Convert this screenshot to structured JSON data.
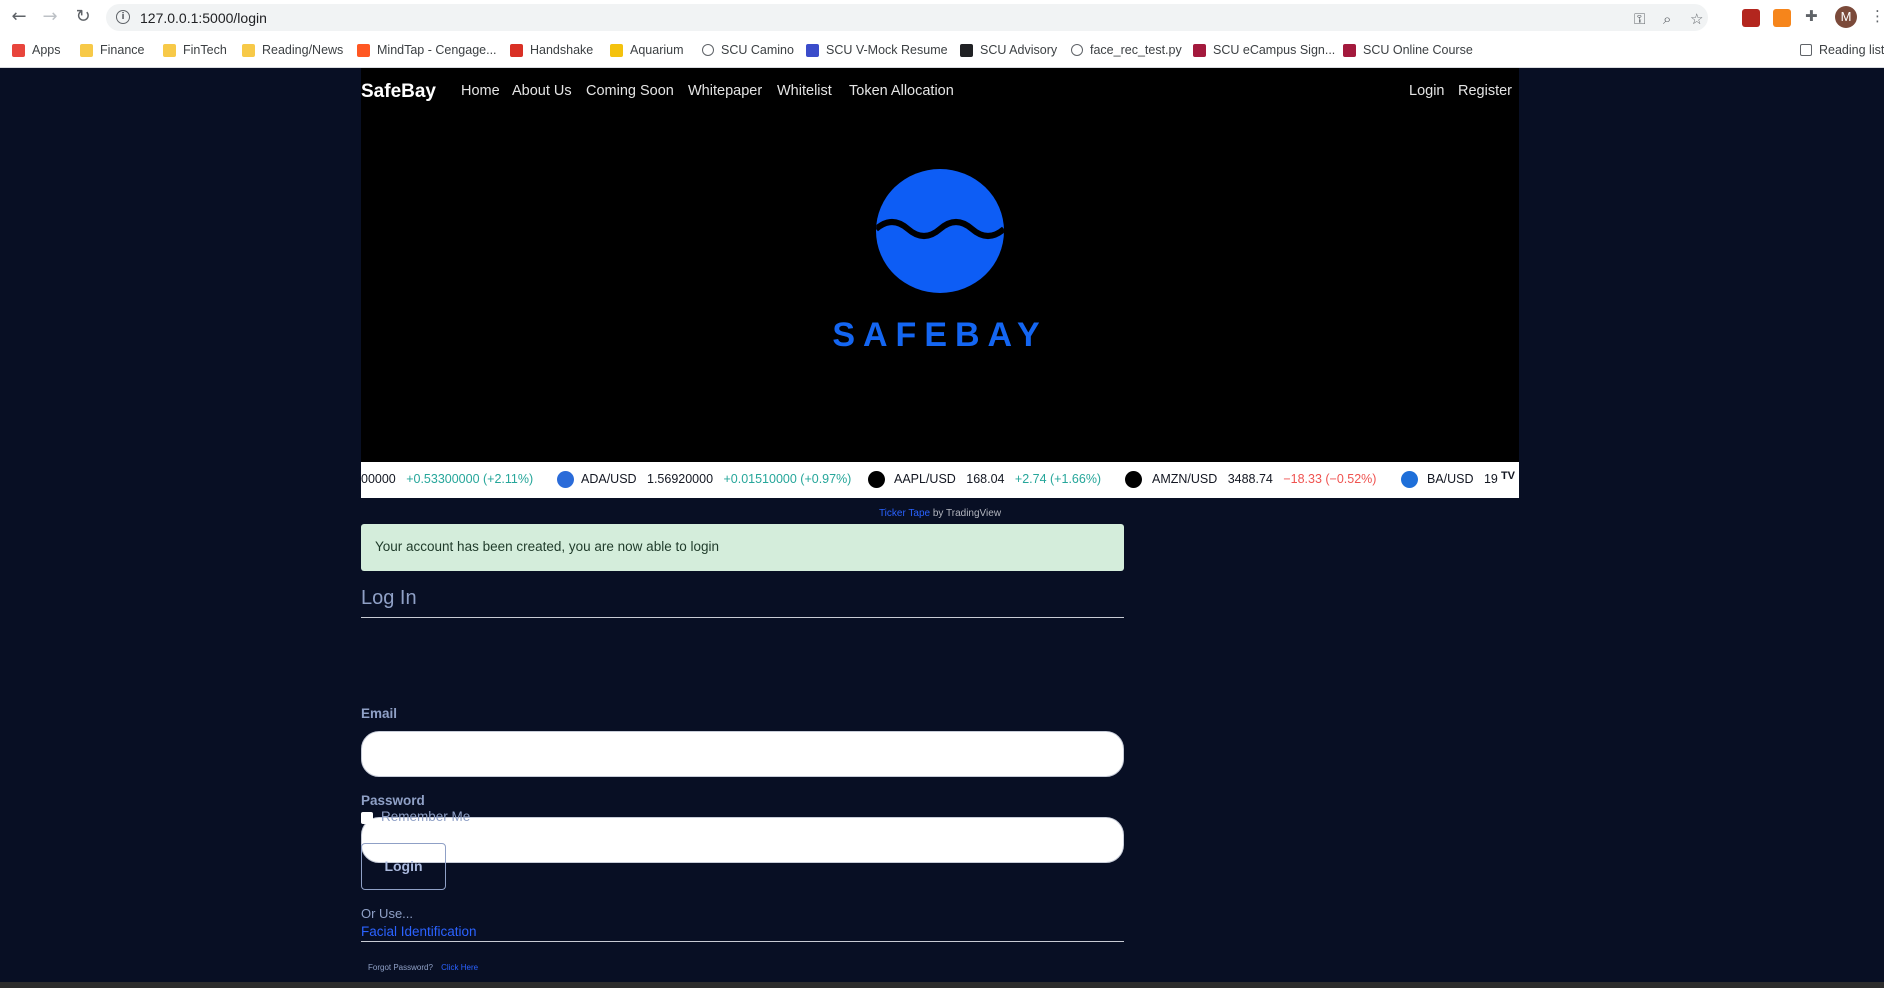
{
  "browser": {
    "url": "127.0.0.1:5000/login",
    "bookmarks": [
      {
        "label": "Apps",
        "icon": "apps-grid-icon",
        "color": "#e8453c"
      },
      {
        "label": "Finance",
        "icon": "folder-icon",
        "color": "#f7c948"
      },
      {
        "label": "FinTech",
        "icon": "folder-icon",
        "color": "#f7c948"
      },
      {
        "label": "Reading/News",
        "icon": "folder-icon",
        "color": "#f7c948"
      },
      {
        "label": "MindTap - Cengage...",
        "icon": "mindtap-icon",
        "color": "#ff5722"
      },
      {
        "label": "Handshake",
        "icon": "handshake-icon",
        "color": "#d93025"
      },
      {
        "label": "Aquarium",
        "icon": "aquarium-icon",
        "color": "#f4c20d"
      },
      {
        "label": "SCU Camino",
        "icon": "globe-icon",
        "color": "#5f6368"
      },
      {
        "label": "SCU V-Mock Resume",
        "icon": "vmock-icon",
        "color": "#3b4cca"
      },
      {
        "label": "SCU Advisory",
        "icon": "advisory-icon",
        "color": "#202124"
      },
      {
        "label": "face_rec_test.py",
        "icon": "globe-icon",
        "color": "#5f6368"
      },
      {
        "label": "SCU eCampus Sign...",
        "icon": "scu-icon",
        "color": "#a3193d"
      },
      {
        "label": "SCU Online Course",
        "icon": "scu-icon",
        "color": "#a3193d"
      }
    ],
    "reading_list": "Reading list",
    "profile_initial": "M"
  },
  "site": {
    "brand": "SafeBay",
    "nav_left": [
      "Home",
      "About Us",
      "Coming Soon",
      "Whitepaper",
      "Whitelist",
      "Token Allocation"
    ],
    "nav_right": [
      "Login",
      "Register"
    ],
    "hero_wordmark": "SAFEBAY",
    "accent_color": "#1466f2"
  },
  "ticker": {
    "items": [
      {
        "symbol": "",
        "price": "00000",
        "change": "+0.53300000 (+2.11%)",
        "direction": "up",
        "icon": ""
      },
      {
        "symbol": "ADA/USD",
        "price": "1.56920000",
        "change": "+0.01510000 (+0.97%)",
        "direction": "up",
        "icon": "cardano-icon"
      },
      {
        "symbol": "AAPL/USD",
        "price": "168.04",
        "change": "+2.74 (+1.66%)",
        "direction": "up",
        "icon": "apple-icon"
      },
      {
        "symbol": "AMZN/USD",
        "price": "3488.74",
        "change": "−18.33 (−0.52%)",
        "direction": "down",
        "icon": "amazon-icon"
      },
      {
        "symbol": "BA/USD",
        "price": "19",
        "change": "",
        "direction": "",
        "icon": "boeing-icon"
      }
    ],
    "credit_link": "Ticker Tape",
    "credit_text": "by TradingView",
    "badge": "TV"
  },
  "login": {
    "alert": "Your account has been created, you are now able to login",
    "title": "Log In",
    "email_label": "Email",
    "email_value": "",
    "password_label": "Password",
    "password_value": "",
    "remember_label": "Remember Me",
    "submit": "Login",
    "or_use": "Or Use...",
    "facial_link": "Facial Identification",
    "forgot_text": "Forgot Password?",
    "forgot_link": "Click Here"
  }
}
